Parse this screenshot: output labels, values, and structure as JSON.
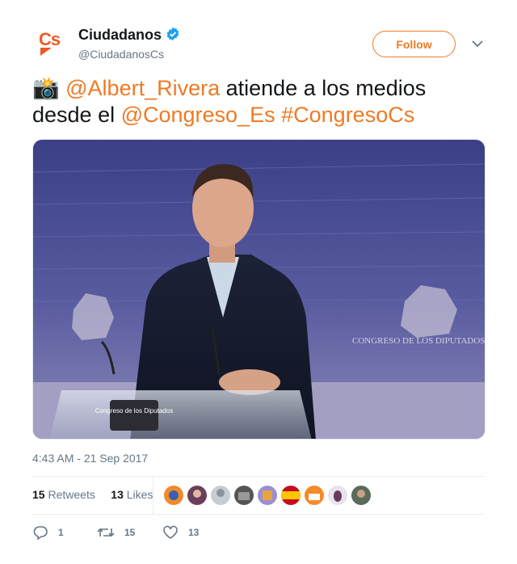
{
  "tweet": {
    "author_name": "Ciudadanos",
    "author_handle": "@CiudadanosCs",
    "avatar_logo": "Cs",
    "follow_label": "Follow",
    "text": {
      "emoji": "📸",
      "mention1": "@Albert_Rivera",
      "part1": " atiende a los medios desde el ",
      "mention2": "@Congreso_Es",
      "space": " ",
      "hashtag": "#CongresoCs"
    },
    "photo": {
      "podium_text": "Congreso de los Diputados",
      "wall_text": "CONGRESO DE LOS DIPUTADOS"
    },
    "timestamp": "4:43 AM - 21 Sep 2017",
    "stats": {
      "retweets_count": "15",
      "retweets_label": "Retweets",
      "likes_count": "13",
      "likes_label": "Likes"
    },
    "actions": {
      "reply_count": "1",
      "retweet_count": "15",
      "like_count": "13"
    }
  },
  "colors": {
    "accent": "#ee7a24",
    "verified": "#1da1f2",
    "muted": "#657786"
  },
  "icons": [
    "verified-badge-icon",
    "chevron-down-icon",
    "camera-flash-icon",
    "reply-icon",
    "retweet-icon",
    "heart-icon"
  ]
}
